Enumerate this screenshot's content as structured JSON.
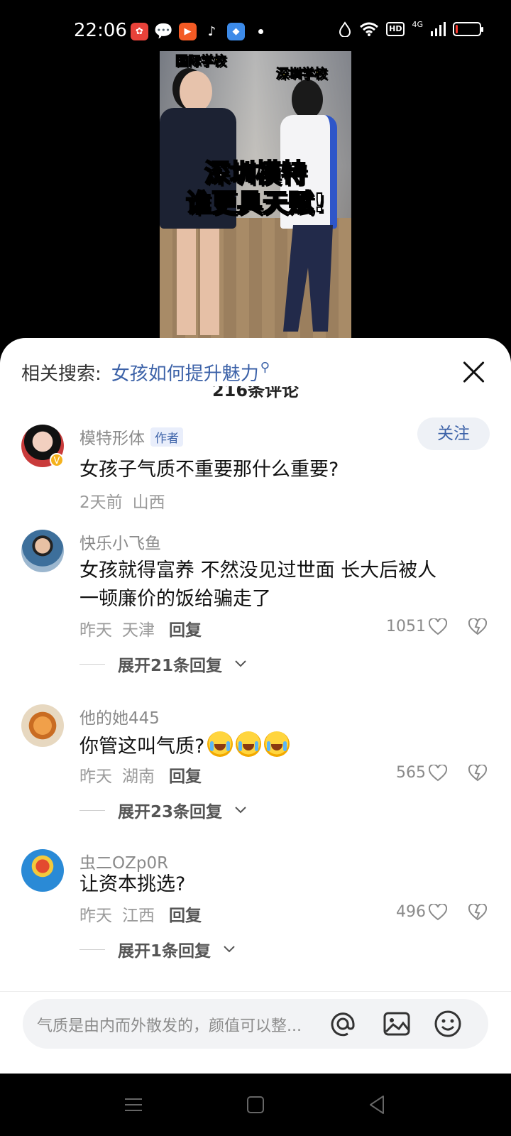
{
  "status_bar": {
    "time": "22:06",
    "network": "4G",
    "hd": "HD",
    "battery_level": 0.1
  },
  "video": {
    "label_left": "国际学校",
    "label_right": "深圳学校",
    "title_line1": "深圳模特",
    "title_line2": "谁更具天赋!"
  },
  "sheet": {
    "related_label": "相关搜索:",
    "related_query": "女孩如何提升魅力",
    "comment_count": "216条评论"
  },
  "comments": [
    {
      "user": "模特形体",
      "author_tag": "作者",
      "follow_label": "关注",
      "text": "女孩子气质不重要那什么重要?",
      "time": "2天前",
      "location": "山西"
    },
    {
      "user": "快乐小飞鱼",
      "text_line1": "女孩就得富养 不然没见过世面 长大后被人",
      "text_line2": "一顿廉价的饭给骗走了",
      "time": "昨天",
      "location": "天津",
      "reply_label": "回复",
      "likes": "1051",
      "expand": "展开21条回复"
    },
    {
      "user": "他的她445",
      "text": "你管这叫气质?",
      "time": "昨天",
      "location": "湖南",
      "reply_label": "回复",
      "likes": "565",
      "expand": "展开23条回复"
    },
    {
      "user": "虫二OZp0R",
      "text": "让资本挑选?",
      "time": "昨天",
      "location": "江西",
      "reply_label": "回复",
      "likes": "496",
      "expand": "展开1条回复"
    }
  ],
  "input": {
    "placeholder": "气质是由内而外散发的，颜值可以整..."
  },
  "colors": {
    "link": "#3c62a8",
    "meta": "#9a9a9a",
    "sheet_bg": "#ffffff"
  }
}
